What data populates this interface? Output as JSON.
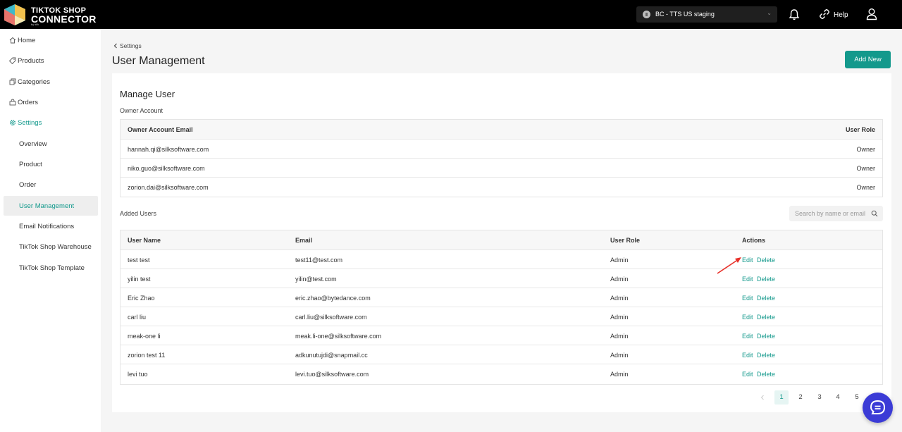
{
  "brand": {
    "name_line1": "TIKTOK SHOP",
    "name_line2": "CONNECTOR",
    "byline": "by silk"
  },
  "topbar": {
    "store_selector": "BC - TTS US staging",
    "help_label": "Help"
  },
  "sidebar": {
    "items": [
      {
        "label": "Home",
        "icon": "home-icon"
      },
      {
        "label": "Products",
        "icon": "tag-icon"
      },
      {
        "label": "Categories",
        "icon": "categories-icon"
      },
      {
        "label": "Orders",
        "icon": "orders-icon"
      },
      {
        "label": "Settings",
        "icon": "gear-icon"
      }
    ],
    "settings_sub": [
      {
        "label": "Overview"
      },
      {
        "label": "Product"
      },
      {
        "label": "Order"
      },
      {
        "label": "User Management"
      },
      {
        "label": "Email Notifications"
      },
      {
        "label": "TikTok Shop Warehouse"
      },
      {
        "label": "TikTok Shop Template"
      }
    ]
  },
  "header": {
    "breadcrumb": "Settings",
    "title": "User Management",
    "add_button": "Add New"
  },
  "card": {
    "title": "Manage User",
    "owner_section": "Owner Account",
    "owner_table": {
      "headers": [
        "Owner Account Email",
        "User Role"
      ],
      "rows": [
        {
          "email": "hannah.qi@silksoftware.com",
          "role": "Owner"
        },
        {
          "email": "niko.guo@silksoftware.com",
          "role": "Owner"
        },
        {
          "email": "zorion.dai@silksoftware.com",
          "role": "Owner"
        }
      ]
    },
    "added_section": "Added Users",
    "search_placeholder": "Search by name or email",
    "users_table": {
      "headers": [
        "User Name",
        "Email",
        "User Role",
        "Actions"
      ],
      "edit_label": "Edit",
      "delete_label": "Delete",
      "rows": [
        {
          "name": "test test",
          "email": "test11@test.com",
          "role": "Admin"
        },
        {
          "name": "yilin test",
          "email": "yilin@test.com",
          "role": "Admin"
        },
        {
          "name": "Eric Zhao",
          "email": "eric.zhao@bytedance.com",
          "role": "Admin"
        },
        {
          "name": "carl liu",
          "email": "carl.liu@silksoftware.com",
          "role": "Admin"
        },
        {
          "name": "meak-one li",
          "email": "meak.li-one@silksoftware.com",
          "role": "Admin"
        },
        {
          "name": "zorion test 11",
          "email": "adkunutujdi@snapmail.cc",
          "role": "Admin"
        },
        {
          "name": "levi tuo",
          "email": "levi.tuo@silksoftware.com",
          "role": "Admin"
        }
      ]
    }
  },
  "pagination": {
    "pages": [
      "1",
      "2",
      "3",
      "4",
      "5"
    ],
    "current": "1",
    "prev_icon": "chevron-left-icon"
  },
  "colors": {
    "accent": "#13998c",
    "topbar": "#000000",
    "chat_button": "#3b3bd6",
    "annotation_arrow": "#e8312a"
  }
}
